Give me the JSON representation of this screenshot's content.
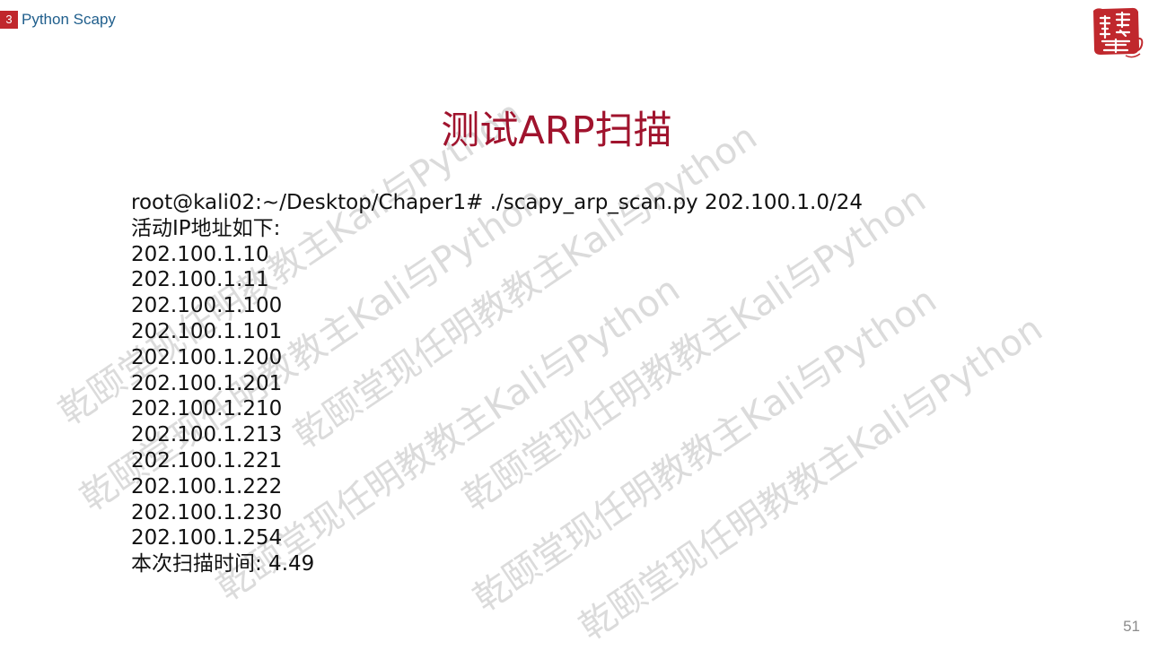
{
  "header": {
    "slide_badge": "3",
    "section_title": "Python Scapy"
  },
  "logo": {
    "icon": "seal-stamp-icon",
    "text": "頤乾堂",
    "color": "#c0282d"
  },
  "slide": {
    "title": "测试ARP扫描",
    "page_number": "51"
  },
  "terminal": {
    "command_line": "root@kali02:~/Desktop/Chaper1# ./scapy_arp_scan.py 202.100.1.0/24",
    "active_label": "活动IP地址如下:",
    "ips": [
      "202.100.1.10",
      "202.100.1.11",
      "202.100.1.100",
      "202.100.1.101",
      "202.100.1.200",
      "202.100.1.201",
      "202.100.1.210",
      "202.100.1.213",
      "202.100.1.221",
      "202.100.1.222",
      "202.100.1.230",
      "202.100.1.254"
    ],
    "scan_time_line": "本次扫描时间: 4.49"
  },
  "watermark": {
    "text": "乾颐堂现任明教教主Kali与Python"
  },
  "colors": {
    "title": "#a0132d",
    "badge": "#c0282d",
    "section": "#1f5e8c"
  }
}
